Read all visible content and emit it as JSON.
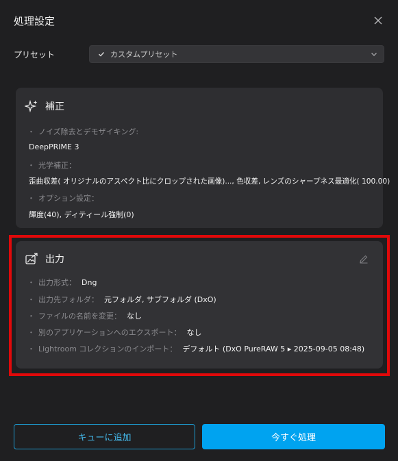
{
  "dialog": {
    "title": "処理設定",
    "close_icon": "close-icon"
  },
  "preset": {
    "label": "プリセット",
    "selected": "カスタムプリセット"
  },
  "correction": {
    "title": "補正",
    "icon": "sparkle-icon",
    "rows": [
      {
        "label": "ノイズ除去とデモザイキング:",
        "value": "DeepPRIME 3"
      },
      {
        "label": "光学補正：",
        "value": "歪曲収差( オリジナルのアスペクト比にクロップされた画像)..., 色収差, レンズのシャープネス最適化( 100.00)"
      },
      {
        "label": "オプション設定：",
        "value": "輝度(40), ディティール強制(0)"
      }
    ]
  },
  "output": {
    "title": "出力",
    "icon": "export-icon",
    "edit_icon": "pencil-icon",
    "rows": [
      {
        "label": "出力形式：",
        "value": "Dng"
      },
      {
        "label": "出力先フォルダ：",
        "value": "元フォルダ, サブフォルダ (DxO)"
      },
      {
        "label": "ファイルの名前を変更：",
        "value": "なし"
      },
      {
        "label": "別のアプリケーションへのエクスポート：",
        "value": "なし"
      },
      {
        "label": "Lightroom コレクションのインポート：",
        "value": "デフォルト (DxO PureRAW 5 ▸ 2025-09-05 08:48)"
      }
    ]
  },
  "actions": {
    "add_to_queue": "キューに追加",
    "process_now": "今すぐ処理"
  },
  "colors": {
    "background": "#1f1f21",
    "card": "#2e2e31",
    "accent": "#00a3f0",
    "highlight": "#e0090a"
  }
}
